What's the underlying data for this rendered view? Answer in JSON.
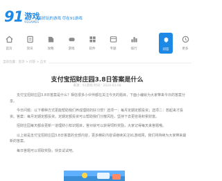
{
  "site": {
    "logo_main": "91",
    "logo_cn": "游戏",
    "logo_en": "91GAMES",
    "slogan": "最好玩的游戏  尽在91游戏"
  },
  "nav": {
    "items": [
      {
        "label": "首页",
        "icon": "home-icon"
      },
      {
        "label": "资讯",
        "icon": "news-icon"
      },
      {
        "label": "攻略",
        "icon": "guide-icon"
      },
      {
        "label": "游戏",
        "icon": "gamepad-icon"
      },
      {
        "label": "软件",
        "icon": "apps-icon"
      },
      {
        "label": "专题",
        "icon": "topic-icon"
      },
      {
        "label": "排行",
        "icon": "rank-icon"
      },
      {
        "label": "问答",
        "icon": "question-icon",
        "active": true
      },
      {
        "label": "更多",
        "icon": "more-icon"
      }
    ]
  },
  "breadcrumb": "当前位置：首页 > 问答 > 正文",
  "article": {
    "title": "支付宝招财庄园3.8日答案是什么",
    "meta": "来源：91游戏  时间：2024-03-08",
    "paragraphs": [
      "支付宝招财庄园3.8日答案是什么？相信很多小伙伴都在关注今天的题目，下面小编就为大家带来今日的答案分享。",
      "今日问题：以下哪种方式更能帮助我们养成理财的好习惯？选项一：每月定期定额投资；选项二：想起来才投资。答案：每月定期定额投资。定期定额投资可以帮助我们分散风险，坚持下去更容易积累财富。",
      "招财庄园每天都会更新一道理财小知识题目，答对就可以获得饲料奖励，大家记得每天来答题哦。",
      "以上就是支付宝招财庄园3.8日答案的全部内容，更多精彩内容请继续关注91游戏网，我们将持续为大家带来最新的答案。",
      "每日答题可以领取奖励，快去试试吧。"
    ]
  },
  "colors": {
    "brand": "#1e88e5",
    "text": "#333333",
    "muted": "#888888"
  }
}
